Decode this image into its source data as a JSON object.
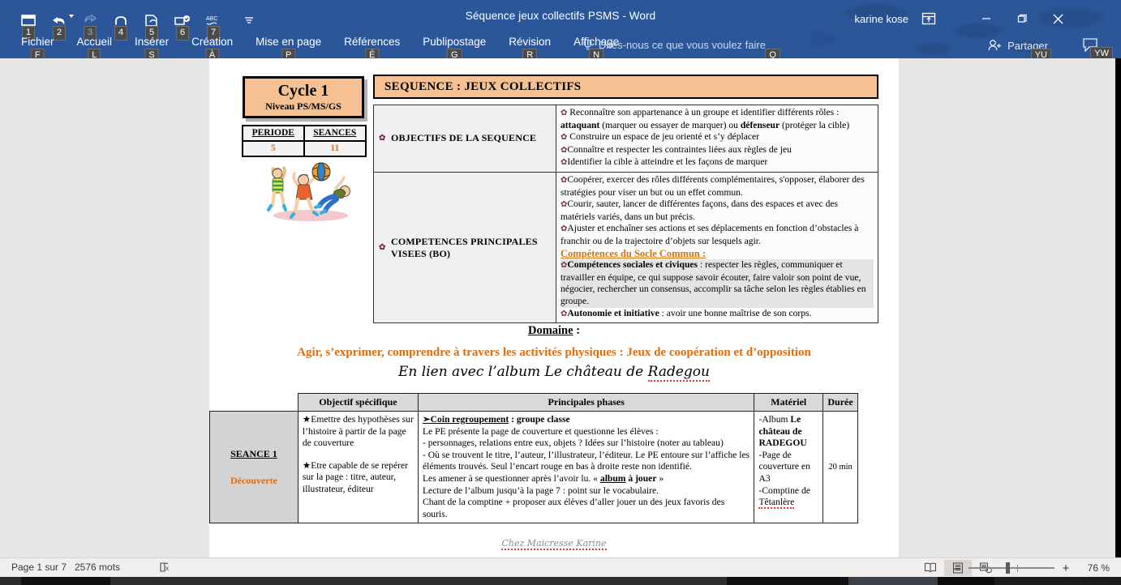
{
  "window": {
    "title": "Séquence jeux collectifs PSMS  -  Word",
    "user": "karine kose",
    "minimize": "–",
    "maximize": "❐",
    "close": "✕"
  },
  "quick_access": [
    {
      "name": "presentation-mode-icon",
      "keytip": "1"
    },
    {
      "name": "undo-icon",
      "keytip": "2"
    },
    {
      "name": "redo-icon",
      "keytip": "3",
      "disabled": true
    },
    {
      "name": "repeat-icon",
      "keytip": "4"
    },
    {
      "name": "print-preview-icon",
      "keytip": "5"
    },
    {
      "name": "email-icon",
      "keytip": "6"
    },
    {
      "name": "spelling-grammar-icon",
      "keytip": "7"
    },
    {
      "name": "customize-qat-icon",
      "keytip": ""
    }
  ],
  "ribbon": {
    "tabs": [
      {
        "label": "Fichier",
        "keytip": "F"
      },
      {
        "label": "Accueil",
        "keytip": "L"
      },
      {
        "label": "Insérer",
        "keytip": "S"
      },
      {
        "label": "Création",
        "keytip": "À"
      },
      {
        "label": "Mise en page",
        "keytip": "P"
      },
      {
        "label": "Références",
        "keytip": "É"
      },
      {
        "label": "Publipostage",
        "keytip": "G"
      },
      {
        "label": "Révision",
        "keytip": "R"
      },
      {
        "label": "Affichage",
        "keytip": "N"
      }
    ],
    "tell_me": "Dites-nous ce que vous voulez faire",
    "tell_me_keytip": "Q",
    "share": "Partager",
    "share_keytip": "YU",
    "comments_keytip": "YW"
  },
  "document": {
    "cycle": {
      "title": "Cycle 1",
      "subtitle": "Niveau PS/MS/GS"
    },
    "period_table": {
      "headers": [
        "PERIODE",
        "SEANCES"
      ],
      "values": [
        "5",
        "11"
      ]
    },
    "sequence_banner": "SEQUENCE : JEUX COLLECTIFS",
    "objectives": {
      "label": "OBJECTIFS DE LA SEQUENCE",
      "lines": [
        "Reconnaître son appartenance à un groupe et identifier différents rôles :",
        "attaquant (marquer ou essayer de marquer) ou défenseur (protéger la cible)",
        "Construire un espace de jeu orienté et s’y déplacer",
        "Connaître et respecter les contraintes liées aux règles de jeu",
        "Identifier la cible à atteindre et les façons de marquer"
      ]
    },
    "competences": {
      "label": "COMPETENCES PRINCIPALES VISEES (BO)",
      "lines": [
        "Coopérer, exercer des rôles différents complémentaires, s'opposer, élaborer des stratégies pour viser un but ou un effet commun.",
        "Courir, sauter, lancer de différentes façons, dans des espaces et avec des matériels variés, dans un but précis.",
        "Ajuster et enchaîner ses actions et ses déplacements en fonction d’obstacles à franchir ou de la trajectoire d’objets sur lesquels agir."
      ],
      "socle_title": "Compétences du Socle Commun :",
      "socle_lines": [
        "Compétences sociales et civiques : respecter les règles, communiquer et travailler en équipe, ce qui suppose savoir écouter, faire valoir son point de vue, négocier, rechercher un consensus, accomplir sa tâche selon les règles établies en groupe.",
        "Autonomie et initiative : avoir une bonne maîtrise de son corps."
      ]
    },
    "domaine": {
      "heading": "Domaine",
      "heading_colon": " :",
      "line2": "Agir, s’exprimer, comprendre à travers les activités physiques : Jeux de coopération et d’opposition",
      "line3_prefix": "En lien avec l’album Le château de ",
      "line3_word": "Radegou"
    },
    "seance_table": {
      "headers": [
        "",
        "Objectif spécifique",
        "Principales phases",
        "Matériel",
        "Durée"
      ],
      "rows": [
        {
          "seance": "SEANCE 1",
          "kind": "Découverte",
          "objectives": [
            "★Emettre des hypothèses sur l’histoire à partir de la page de couverture",
            "★Etre capable de se repérer sur la page : titre, auteur, illustrateur, éditeur"
          ],
          "phase_title": "➢Coin regroupement",
          "phase_title_rest": " : groupe classe",
          "phase_lines": [
            "Le PE présente la page de couverture et questionne les élèves :",
            "- personnages, relations entre eux, objets ?  Idées sur l’histoire (noter au tableau)",
            "- Où se trouvent le titre, l’auteur, l’illustrateur, l’éditeur. Le PE entoure sur l’affiche les éléments trouvés. Seul l’encart rouge en bas à droite reste non identifié.",
            "Lecture de l’album jusqu’à la page 7 : point sur le vocabulaire.",
            "Chant de la comptine + proposer aux élèves d’aller jouer un des jeux favoris des souris."
          ],
          "phase_quote_prefix": " Les amener à se questionner après l’avoir lu. « ",
          "phase_quote_bold": "album",
          "phase_quote_mid": " à jouer",
          "phase_quote_suffix": " »",
          "materiel_lines": [
            "-Album Le château de RADEGOU",
            "-Page de couverture en A3",
            "-Comptine de Têtanlère"
          ],
          "duree": "20 min"
        }
      ]
    },
    "footer": "Chez Maicresse Karine"
  },
  "status_bar": {
    "page": "Page 1 sur 7",
    "words": "2576 mots",
    "language_icon": "proofing-errors-icon",
    "views": [
      {
        "name": "read-mode-icon",
        "active": false
      },
      {
        "name": "print-layout-icon",
        "active": true
      },
      {
        "name": "web-layout-icon",
        "active": false
      }
    ],
    "zoom_out": "–",
    "zoom_in": "+",
    "zoom_value": "76 %"
  },
  "colors": {
    "ribbon_blue": "#2b579a",
    "accent_orange": "#e06c12",
    "banner_peach": "#f5c193",
    "socle_orange": "#d4740f"
  }
}
